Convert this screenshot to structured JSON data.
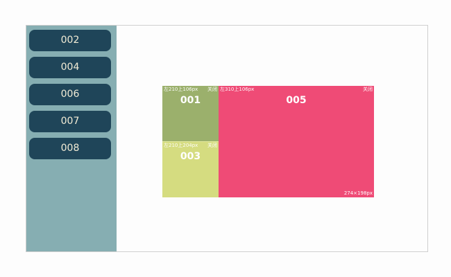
{
  "sidebar": {
    "items": [
      {
        "label": "002"
      },
      {
        "label": "004"
      },
      {
        "label": "006"
      },
      {
        "label": "007"
      },
      {
        "label": "008"
      }
    ]
  },
  "panels": {
    "p001": {
      "label": "001",
      "coord": "左210上106px",
      "close": "关闭",
      "color": "#9bb06c"
    },
    "p003": {
      "label": "003",
      "coord": "左210上204px",
      "close": "关闭",
      "color": "#d5dc80"
    },
    "p005": {
      "label": "005",
      "coord": "左310上106px",
      "close": "关闭",
      "size": "274×198px",
      "color": "#ef4b76"
    }
  },
  "colors": {
    "sidebar_bg": "#86aeb2",
    "button_bg": "#1f4559",
    "button_text": "#f2ecd6"
  }
}
